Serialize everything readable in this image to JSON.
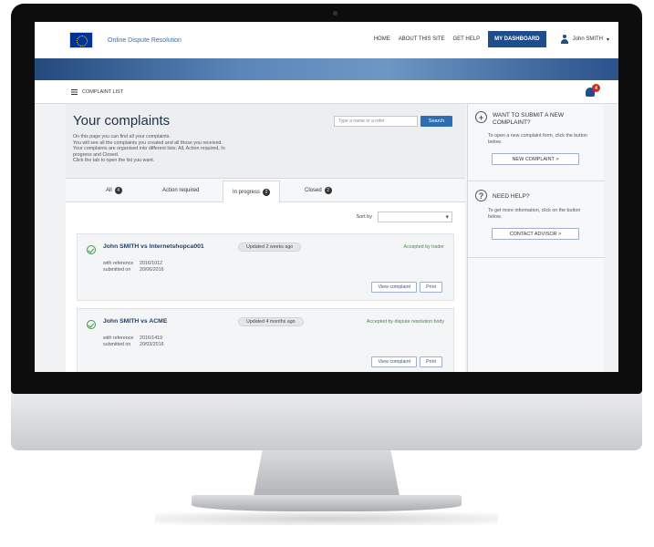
{
  "header": {
    "brand": "Online Dispute Resolution",
    "nav": [
      "HOME",
      "ABOUT THIS SITE",
      "GET HELP"
    ],
    "dashboard": "MY DASHBOARD",
    "user": "John SMITH"
  },
  "breadcrumb": {
    "label": "COMPLAINT LIST",
    "notification_count": "4"
  },
  "page": {
    "title": "Your complaints",
    "intro": [
      "On this page you can find all your complaints.",
      "You will see all the complaints you created and all those you received.",
      "Your complaints are organised into different lists: All, Action required, In",
      "progress and Closed.",
      "Click the tab to open the list you want."
    ],
    "search_placeholder": "Type a name or a refer",
    "search_button": "Search"
  },
  "tabs": [
    {
      "label": "All",
      "count": "4"
    },
    {
      "label": "Action required",
      "count": ""
    },
    {
      "label": "In progress",
      "count": "2"
    },
    {
      "label": "Closed",
      "count": "2"
    }
  ],
  "sort": {
    "label": "Sort by",
    "value": ""
  },
  "complaints": [
    {
      "title": "John SMITH vs Internetshopca001",
      "ref_key": "with reference",
      "ref_value": "2016/1012",
      "submitted_key": "submitted on",
      "submitted_value": "20/06/2016",
      "updated": "Updated 2 weeks ago",
      "status": "Accepted by trader",
      "view": "View complaint",
      "print": "Print"
    },
    {
      "title": "John SMITH vs ACME",
      "ref_key": "with reference",
      "ref_value": "2016/1419",
      "submitted_key": "submitted on",
      "submitted_value": "20/03/2016",
      "updated": "Updated 4 months ago",
      "status": "Accepted by dispute resolution body",
      "view": "View complaint",
      "print": "Print"
    }
  ],
  "sidebar": {
    "submit": {
      "icon": "plus-icon",
      "heading": "WANT TO SUBMIT A NEW COMPLAINT?",
      "text": "To open a new complaint form, click the button below.",
      "button": "NEW COMPLAINT >"
    },
    "help": {
      "icon": "question-icon",
      "heading": "NEED HELP?",
      "text": "To get more information, click on the button below.",
      "button": "CONTACT ADVISOR >"
    }
  }
}
